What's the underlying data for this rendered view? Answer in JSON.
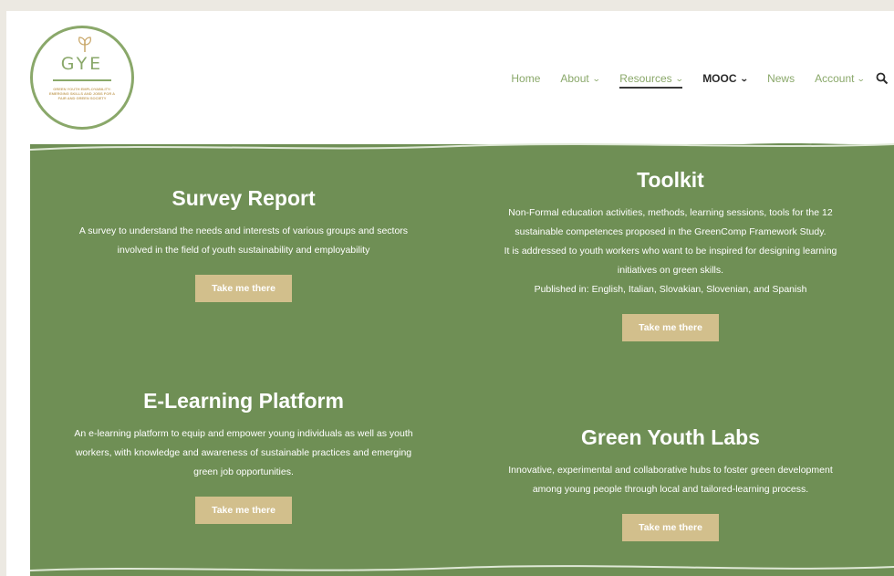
{
  "logo": {
    "text": "GYE",
    "tagline": "GREEN YOUTH EMPLOYABILITY: EMERGING SKILLS AND JOBS FOR A FAIR AND GREEN SOCIETY"
  },
  "nav": {
    "items": [
      {
        "label": "Home",
        "dropdown": false
      },
      {
        "label": "About",
        "dropdown": true
      },
      {
        "label": "Resources",
        "dropdown": true
      },
      {
        "label": "MOOC",
        "dropdown": true
      },
      {
        "label": "News",
        "dropdown": false
      },
      {
        "label": "Account",
        "dropdown": true
      }
    ],
    "search_icon": "search-icon"
  },
  "sections": {
    "survey": {
      "title": "Survey Report",
      "lines": [
        "A survey to understand the needs and interests of various groups and sectors",
        "involved in the field of youth sustainability and employability"
      ],
      "button": "Take me there"
    },
    "toolkit": {
      "title": "Toolkit",
      "lines": [
        "Non-Formal education activities, methods, learning sessions, tools for the 12",
        "sustainable competences proposed in the GreenComp Framework Study.",
        "It is addressed to youth workers who want to be inspired for designing learning",
        "initiatives on green skills.",
        "Published in: English, Italian, Slovakian, Slovenian, and Spanish"
      ],
      "button": "Take me there"
    },
    "elearning": {
      "title": "E-Learning Platform",
      "lines": [
        "An e-learning platform to equip and empower young individuals as well as youth",
        "workers, with knowledge and awareness of sustainable practices and emerging",
        "green job opportunities."
      ],
      "button": "Take me there"
    },
    "labs": {
      "title": "Green Youth Labs",
      "lines": [
        "Innovative, experimental and collaborative hubs to foster green development",
        "among young people through local and tailored-learning process."
      ],
      "button": "Take me there"
    }
  },
  "colors": {
    "green_bg": "#6f8f55",
    "button": "#d2bf8c",
    "nav_text": "#8aa86a",
    "page_bg": "#ece9e2"
  }
}
